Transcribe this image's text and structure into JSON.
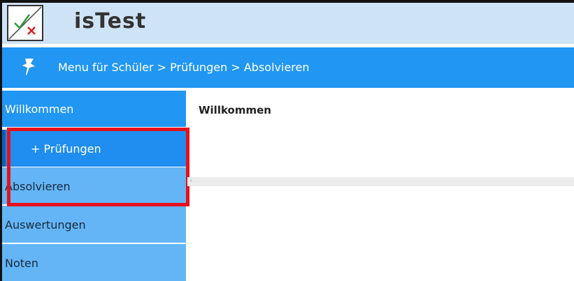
{
  "header": {
    "app_title": "isTest",
    "logo_icon": "check-cross-logo-icon"
  },
  "navbar": {
    "icon": "pushpin-icon",
    "breadcrumb": "Menu für Schüler > Prüfungen > Absolvieren"
  },
  "sidebar": {
    "items": [
      {
        "label": "Willkommen"
      },
      {
        "label": "+ Prüfungen"
      },
      {
        "label": "Absolvieren"
      },
      {
        "label": "Auswertungen"
      },
      {
        "label": "Noten"
      }
    ]
  },
  "main": {
    "title": "Willkommen",
    "scroll_left_glyph": "‹"
  },
  "colors": {
    "header_bg": "#cfe3f7",
    "navbar_bg": "#2196f3",
    "sidebar_active": "#2196f3",
    "sidebar_item": "#64b5f6",
    "highlight": "#e8101a"
  }
}
